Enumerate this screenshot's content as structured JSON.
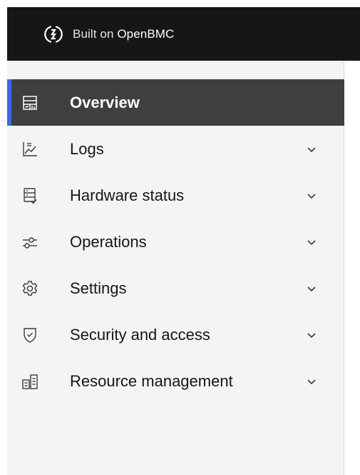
{
  "header": {
    "brand_prefix": "Built on",
    "brand_name": "OpenBMC",
    "logo_icon": "openbmc-logo-icon",
    "background": "#161616"
  },
  "sidebar": {
    "background": "#f3f4f4",
    "active_background": "#3f3f3f",
    "active_accent": "#3b6ae8",
    "items": [
      {
        "label": "Overview",
        "icon": "dashboard-icon",
        "active": true,
        "expandable": false
      },
      {
        "label": "Logs",
        "icon": "chart-list-icon",
        "active": false,
        "expandable": true
      },
      {
        "label": "Hardware status",
        "icon": "server-check-icon",
        "active": false,
        "expandable": true
      },
      {
        "label": "Operations",
        "icon": "sliders-icon",
        "active": false,
        "expandable": true
      },
      {
        "label": "Settings",
        "icon": "gear-icon",
        "active": false,
        "expandable": true
      },
      {
        "label": "Security and access",
        "icon": "shield-check-icon",
        "active": false,
        "expandable": true
      },
      {
        "label": "Resource management",
        "icon": "resources-icon",
        "active": false,
        "expandable": true
      }
    ]
  }
}
